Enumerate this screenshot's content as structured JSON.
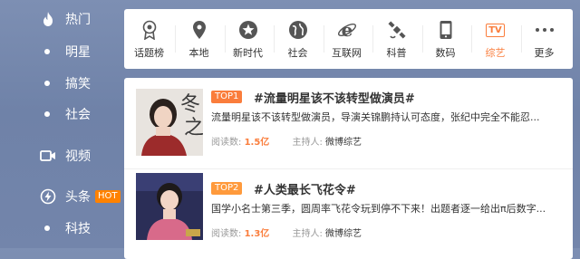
{
  "sidebar": {
    "items": [
      {
        "label": "热门",
        "icon": "fire-icon",
        "hot": false
      },
      {
        "label": "明星",
        "icon": "dot",
        "hot": false
      },
      {
        "label": "搞笑",
        "icon": "dot",
        "hot": false
      },
      {
        "label": "社会",
        "icon": "dot",
        "hot": false
      },
      {
        "label": "视频",
        "icon": "video-icon",
        "hot": false
      },
      {
        "label": "头条",
        "icon": "lightning-icon",
        "hot": true
      },
      {
        "label": "科技",
        "icon": "dot",
        "hot": false
      }
    ],
    "hot_badge": "HOT"
  },
  "nav": {
    "items": [
      {
        "label": "话题榜",
        "icon": "ribbon-medal-icon"
      },
      {
        "label": "本地",
        "icon": "location-pin-icon"
      },
      {
        "label": "新时代",
        "icon": "star-badge-icon"
      },
      {
        "label": "社会",
        "icon": "globe-icon"
      },
      {
        "label": "互联网",
        "icon": "ie-browser-icon"
      },
      {
        "label": "科普",
        "icon": "satellite-icon"
      },
      {
        "label": "数码",
        "icon": "phone-icon"
      },
      {
        "label": "综艺",
        "icon": "tv-icon",
        "icon_text": "TV",
        "active": true
      },
      {
        "label": "更多",
        "icon": "more-dots-icon",
        "icon_text": "• • •"
      }
    ],
    "active_color": "#fa7d3c"
  },
  "topics": [
    {
      "rank": "TOP1",
      "title": "#流量明星该不该转型做演员#",
      "desc": "流量明星该不该转型做演员，导演关锦鹏持认可态度，张纪中完全不能忍...",
      "reads_label": "阅读数:",
      "reads": "1.5亿",
      "host_label": "主持人:",
      "host": "微博综艺",
      "thumb": "actress-portrait-image"
    },
    {
      "rank": "TOP2",
      "title": "#人类最长飞花令#",
      "desc": "国学小名士第三季，圆周率飞花令玩到停不下来！出题者逐一给出π后数字...",
      "reads_label": "阅读数:",
      "reads": "1.3亿",
      "host_label": "主持人:",
      "host": "微博综艺",
      "thumb": "girl-portrait-image"
    }
  ]
}
